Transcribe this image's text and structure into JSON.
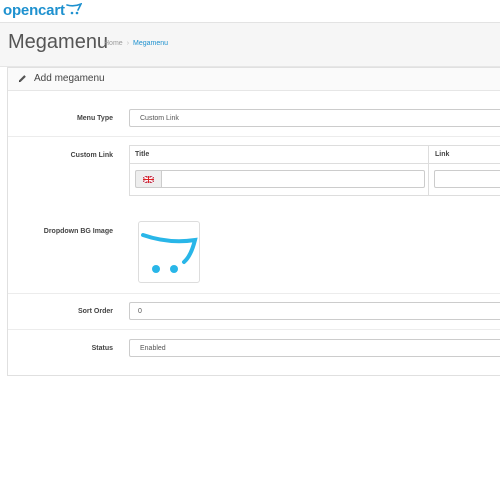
{
  "header": {
    "logo_text": "opencart",
    "brand_color": "#1e91cf"
  },
  "page": {
    "title": "Megamenu",
    "breadcrumb": [
      {
        "label": "Home"
      },
      {
        "label": "Megamenu"
      }
    ],
    "breadcrumb_separator": "›"
  },
  "panel": {
    "title": "Add megamenu",
    "title_icon": "pencil-icon"
  },
  "form": {
    "menu_type": {
      "label": "Menu Type",
      "value": "Custom Link"
    },
    "custom_link": {
      "label": "Custom Link",
      "columns": [
        "Title",
        "Link"
      ],
      "title_value": "",
      "link_value": "",
      "language_icon": "english-flag-icon"
    },
    "dropdown_bg_image": {
      "label": "Dropdown BG Image",
      "image_icon": "opencart-cart-image"
    },
    "sort_order": {
      "label": "Sort Order",
      "value": "0"
    },
    "status": {
      "label": "Status",
      "value": "Enabled"
    }
  }
}
